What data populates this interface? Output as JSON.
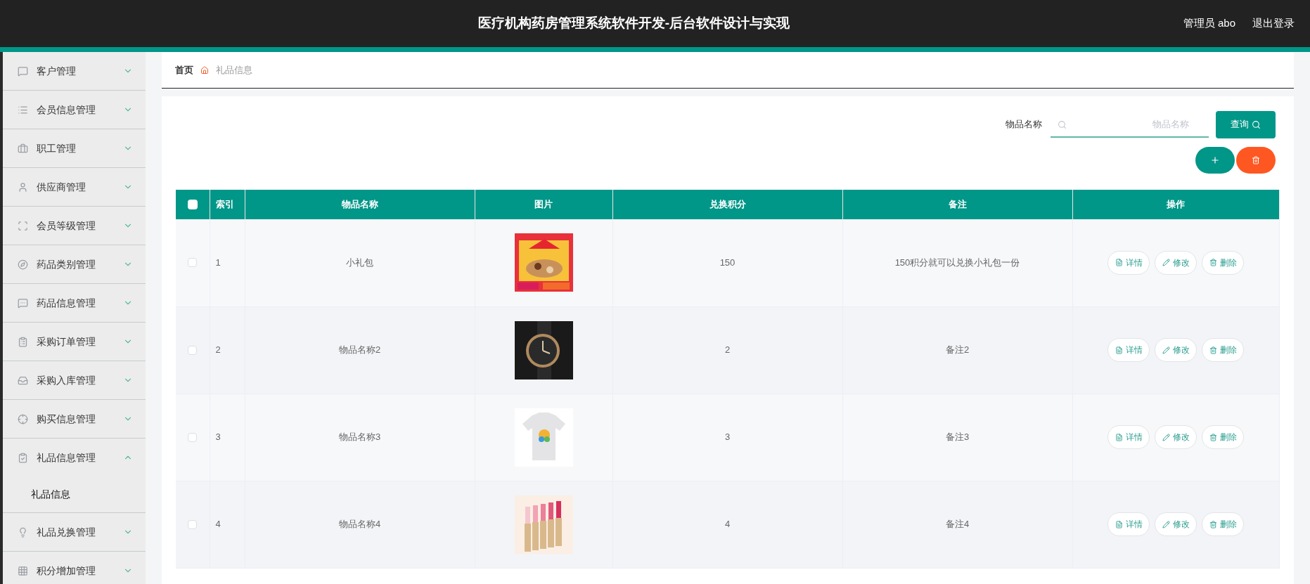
{
  "header": {
    "title": "医疗机构药房管理系统软件开发-后台软件设计与实现",
    "user": "管理员 abo",
    "logout": "退出登录"
  },
  "sidebar": {
    "items": [
      {
        "label": "客户管理",
        "expanded": false
      },
      {
        "label": "会员信息管理",
        "expanded": false
      },
      {
        "label": "职工管理",
        "expanded": false
      },
      {
        "label": "供应商管理",
        "expanded": false
      },
      {
        "label": "会员等级管理",
        "expanded": false
      },
      {
        "label": "药品类别管理",
        "expanded": false
      },
      {
        "label": "药品信息管理",
        "expanded": false
      },
      {
        "label": "采购订单管理",
        "expanded": false
      },
      {
        "label": "采购入库管理",
        "expanded": false
      },
      {
        "label": "购买信息管理",
        "expanded": false
      },
      {
        "label": "礼品信息管理",
        "expanded": true,
        "children": [
          {
            "label": "礼品信息",
            "selected": true
          }
        ]
      },
      {
        "label": "礼品兑换管理",
        "expanded": false
      },
      {
        "label": "积分增加管理",
        "expanded": false
      }
    ]
  },
  "breadcrumb": [
    "首页",
    "礼品信息"
  ],
  "search": {
    "label": "物品名称",
    "placeholder": "物品名称",
    "button": "查询"
  },
  "table": {
    "header_checked": false,
    "columns": [
      "索引",
      "物品名称",
      "图片",
      "兑换积分",
      "备注",
      "操作"
    ],
    "rows": [
      {
        "checked": false,
        "index": "1",
        "name": "小礼包",
        "picture": {
          "kind": "picture"
        },
        "points": "150",
        "note": "150积分就可以兑换小礼包一份",
        "actions": [
          "详情",
          "修改",
          "删除"
        ]
      },
      {
        "checked": false,
        "index": "2",
        "name": "物品名称2",
        "picture": {
          "kind": "picture"
        },
        "points": "2",
        "note": "备注2",
        "actions": [
          "详情",
          "修改",
          "删除"
        ]
      },
      {
        "checked": false,
        "index": "3",
        "name": "物品名称3",
        "picture": {
          "kind": "picture"
        },
        "points": "3",
        "note": "备注3",
        "actions": [
          "详情",
          "修改",
          "删除"
        ]
      },
      {
        "checked": false,
        "index": "4",
        "name": "物品名称4",
        "picture": {
          "kind": "picture"
        },
        "points": "4",
        "note": "备注4",
        "actions": [
          "详情",
          "修改",
          "删除"
        ]
      }
    ]
  }
}
